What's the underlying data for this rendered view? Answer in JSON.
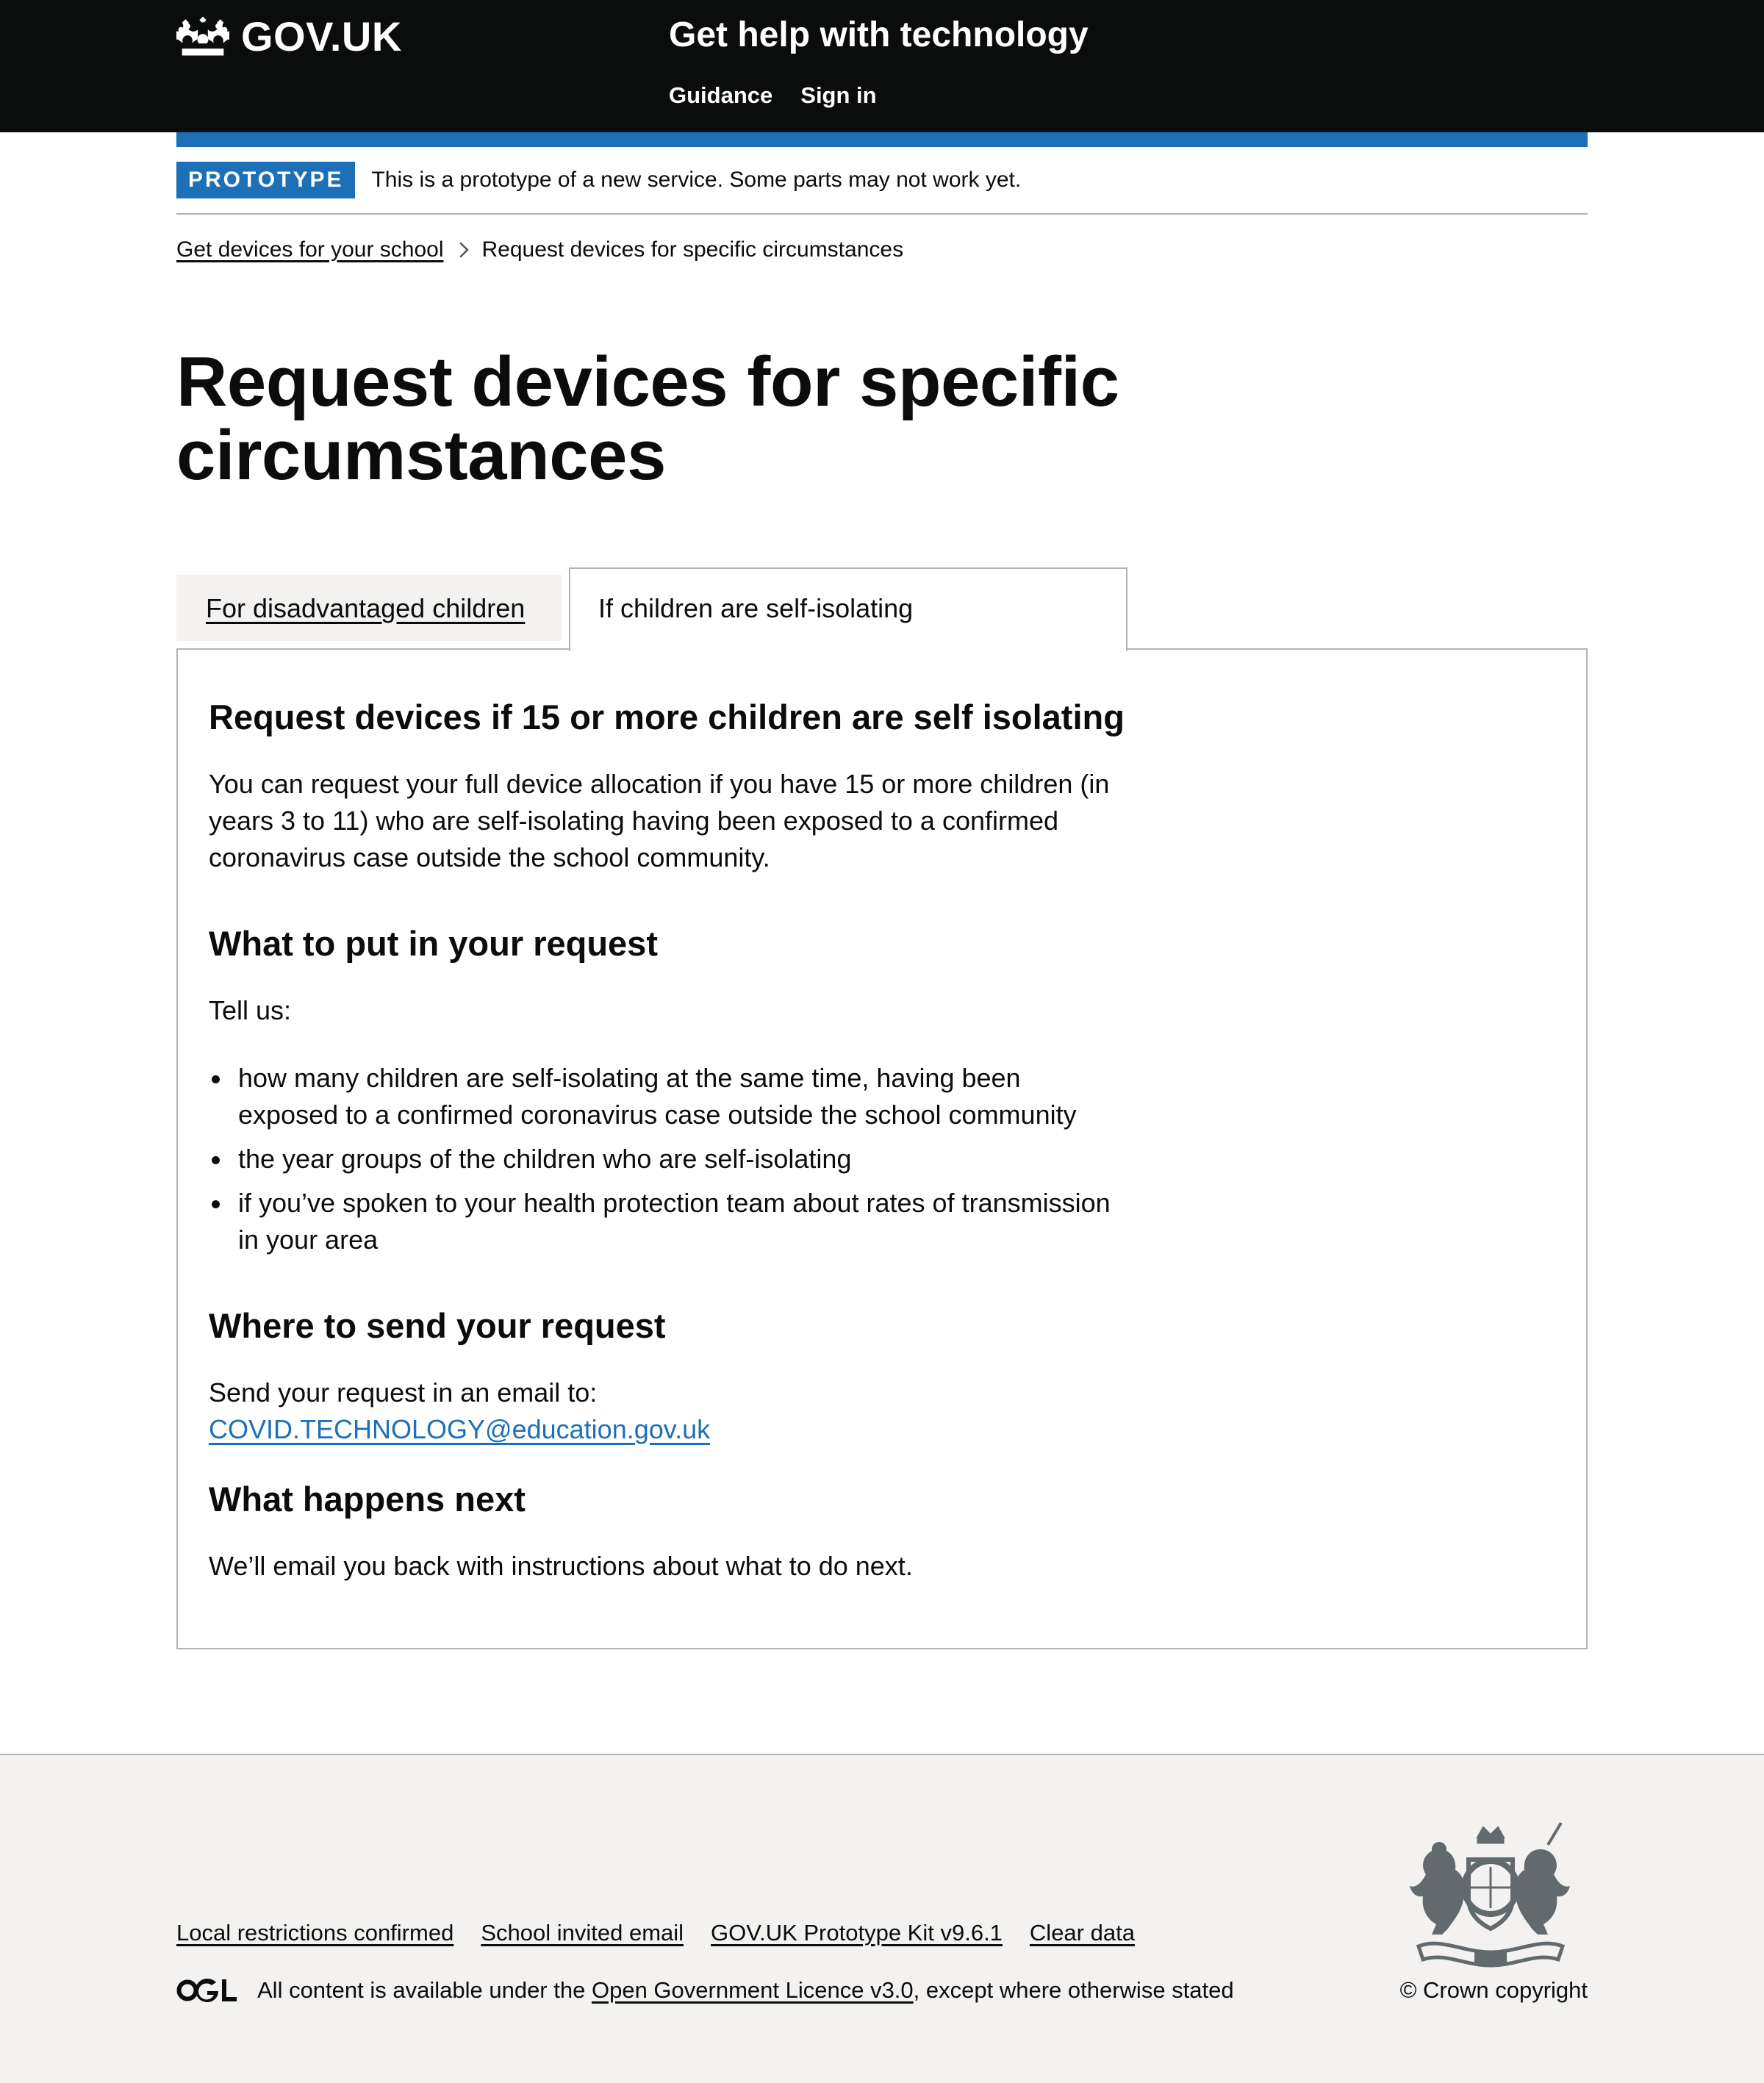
{
  "header": {
    "logo_text": "GOV.UK",
    "service_name": "Get help with technology",
    "nav": [
      {
        "label": "Guidance"
      },
      {
        "label": "Sign in"
      }
    ]
  },
  "phase_banner": {
    "tag": "PROTOTYPE",
    "text": "This is a prototype of a new service. Some parts may not work yet."
  },
  "breadcrumbs": {
    "parent": "Get devices for your school",
    "current": "Request devices for specific circumstances"
  },
  "page_title": "Request devices for specific circumstances",
  "tabs": {
    "items": [
      {
        "label": "For disadvantaged children",
        "selected": false
      },
      {
        "label": "If children are self-isolating",
        "selected": true
      }
    ],
    "panel": {
      "heading": "Request devices if 15 or more children are self isolating",
      "intro": "You can request your full device allocation if you have 15 or more children (in years 3 to 11) who are self-isolating having been exposed to a confirmed coronavirus case outside the school community.",
      "request_heading": "What to put in your request",
      "tell_us": "Tell us:",
      "bullets": [
        "how many children are self-isolating at the same time, having been exposed to a confirmed coronavirus case outside the school community",
        "the year groups of the children who are self-isolating",
        "if you’ve spoken to your health protection team about rates of transmission in your area"
      ],
      "send_heading": "Where to send your request",
      "send_text": "Send your request in an email to:",
      "email": "COVID.TECHNOLOGY@education.gov.uk",
      "next_heading": "What happens next",
      "next_text": "We’ll email you back with instructions about what to do next."
    }
  },
  "footer": {
    "links": [
      {
        "label": "Local restrictions confirmed"
      },
      {
        "label": "School invited email"
      },
      {
        "label": "GOV.UK Prototype Kit v9.6.1"
      },
      {
        "label": "Clear data"
      }
    ],
    "licence_prefix": "All content is available under the",
    "licence_link": "Open Government Licence v3.0",
    "licence_suffix": ", except where otherwise stated",
    "copyright": "© Crown copyright"
  },
  "colors": {
    "header_bg": "#0b0c0c",
    "brand_blue": "#1d70b8",
    "footer_bg": "#f3f2f1",
    "border_grey": "#b1b4b6"
  },
  "icons": [
    "crown-icon",
    "chevron-right-icon",
    "ogl-logo-icon",
    "royal-coat-of-arms-icon"
  ]
}
